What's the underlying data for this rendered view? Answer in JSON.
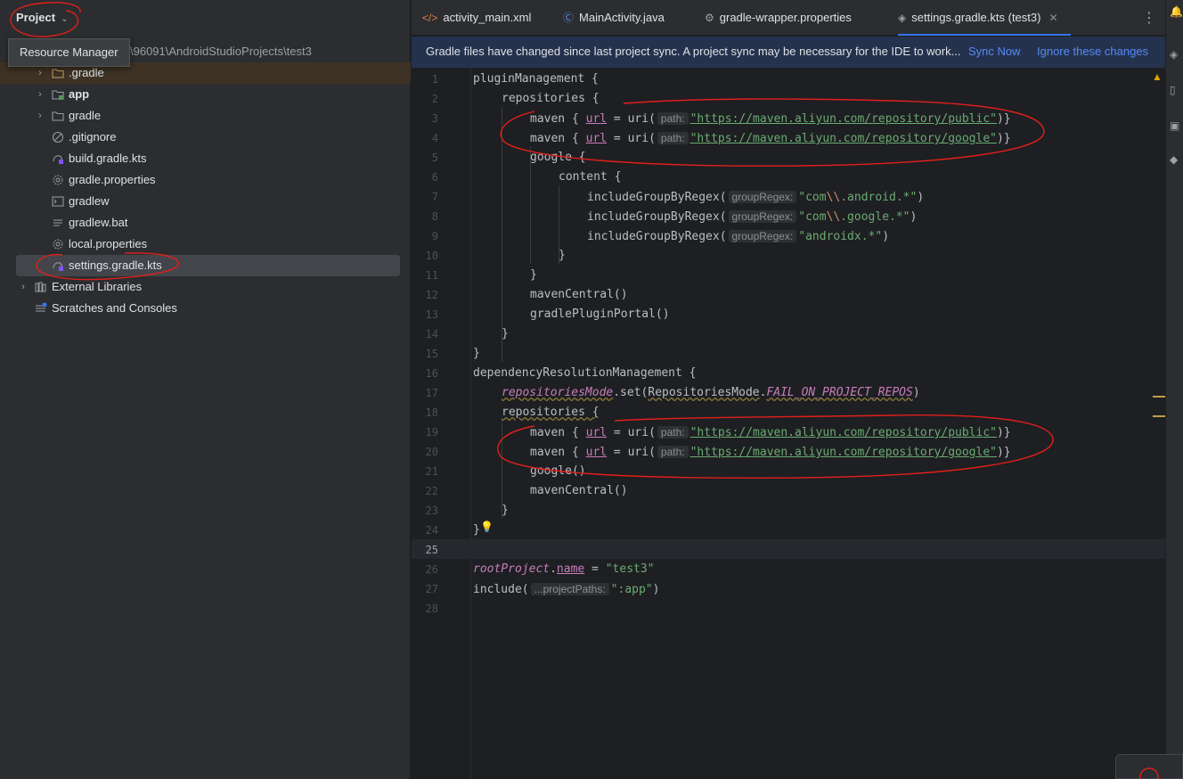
{
  "project_panel": {
    "title": "Project",
    "tooltip": "Resource Manager",
    "path_text": "\\96091\\AndroidStudioProjects\\test3",
    "items": [
      {
        "label": ".gradle",
        "icon": "folder-icon",
        "expandable": true
      },
      {
        "label": "app",
        "icon": "module-folder-icon",
        "expandable": true,
        "bold": true
      },
      {
        "label": "gradle",
        "icon": "folder-icon",
        "expandable": true
      },
      {
        "label": ".gitignore",
        "icon": "ignore-file-icon",
        "expandable": false
      },
      {
        "label": "build.gradle.kts",
        "icon": "gradle-file-icon",
        "expandable": false
      },
      {
        "label": "gradle.properties",
        "icon": "settings-file-icon",
        "expandable": false
      },
      {
        "label": "gradlew",
        "icon": "terminal-file-icon",
        "expandable": false
      },
      {
        "label": "gradlew.bat",
        "icon": "text-file-icon",
        "expandable": false
      },
      {
        "label": "local.properties",
        "icon": "settings-file-icon",
        "expandable": false
      },
      {
        "label": "settings.gradle.kts",
        "icon": "gradle-file-icon",
        "expandable": false,
        "selected": true
      },
      {
        "label": "External Libraries",
        "icon": "library-icon",
        "expandable": true
      },
      {
        "label": "Scratches and Consoles",
        "icon": "scratches-icon",
        "expandable": false
      }
    ]
  },
  "tabs": [
    {
      "label": "activity_main.xml",
      "icon": "xml-file-icon"
    },
    {
      "label": "MainActivity.java",
      "icon": "java-class-icon"
    },
    {
      "label": "gradle-wrapper.properties",
      "icon": "settings-file-icon"
    },
    {
      "label": "settings.gradle.kts (test3)",
      "icon": "gradle-file-icon",
      "active": true
    }
  ],
  "banner": {
    "message": "Gradle files have changed since last project sync. A project sync may be necessary for the IDE to work...",
    "sync_now": "Sync Now",
    "ignore": "Ignore these changes"
  },
  "editor": {
    "line_numbers": [
      "1",
      "2",
      "3",
      "4",
      "5",
      "6",
      "7",
      "8",
      "9",
      "10",
      "11",
      "12",
      "13",
      "14",
      "15",
      "16",
      "17",
      "18",
      "19",
      "20",
      "21",
      "22",
      "23",
      "24",
      "25",
      "26",
      "27",
      "28"
    ],
    "current_line": "25",
    "tokens": {
      "l1": "pluginManagement {",
      "l2": "repositories {",
      "maven_prefix": "maven { ",
      "url": "url",
      "eq_uri": " = uri(",
      "hint_path": "path:",
      "url_public": "\"https://maven.aliyun.com/repository/public\"",
      "url_google": "\"https://maven.aliyun.com/repository/google\"",
      "close_paren_brace": ")}",
      "l5": "google {",
      "l6": "content {",
      "include_fn": "includeGroupByRegex(",
      "hint_group": "groupRegex:",
      "re1_a": "\"com",
      "re_esc": "\\\\",
      "re1_b": ".android.*\"",
      "re2_b": ".google.*\"",
      "re3": "\"androidx.*\"",
      "close_paren": ")",
      "close_brace": "}",
      "maven_central": "mavenCentral()",
      "gradle_plugin_portal": "gradlePluginPortal()",
      "l16": "dependencyResolutionManagement {",
      "repositories_mode": "repositoriesMode",
      "set_open": ".set(",
      "rm_class": "RepositoriesMode",
      "dot": ".",
      "fail_on": "FAIL_ON_PROJECT_REPOS",
      "google_call": "google()",
      "root_project": "rootProject",
      "name_prop": "name",
      "eq": " = ",
      "test3": "\"test3\"",
      "include_call": "include(",
      "hint_project_paths": "...projectPaths:",
      "app_path": "\":app\""
    }
  },
  "colors": {
    "accent": "#3574f0",
    "link": "#548af7",
    "string": "#6aab73",
    "property": "#c77dbb",
    "annotation": "#e0201b"
  }
}
